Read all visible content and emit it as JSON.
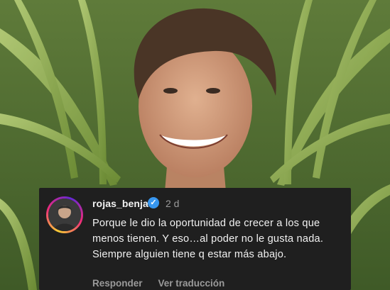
{
  "comment": {
    "username": "rojas_benja",
    "verified_icon": "verified-badge-icon",
    "timestamp": "2 d",
    "text": "Porque le dio la oportunidad de crecer a los que menos tienen. Y eso…al poder no le gusta nada. Siempre alguien tiene q estar más abajo.",
    "reply_label": "Responder",
    "translate_label": "Ver traducción"
  },
  "colors": {
    "card_bg": "#1f1f1f",
    "text_primary": "#f1f1f1",
    "text_secondary": "#9a9a9a",
    "verified_blue": "#3797f0"
  }
}
